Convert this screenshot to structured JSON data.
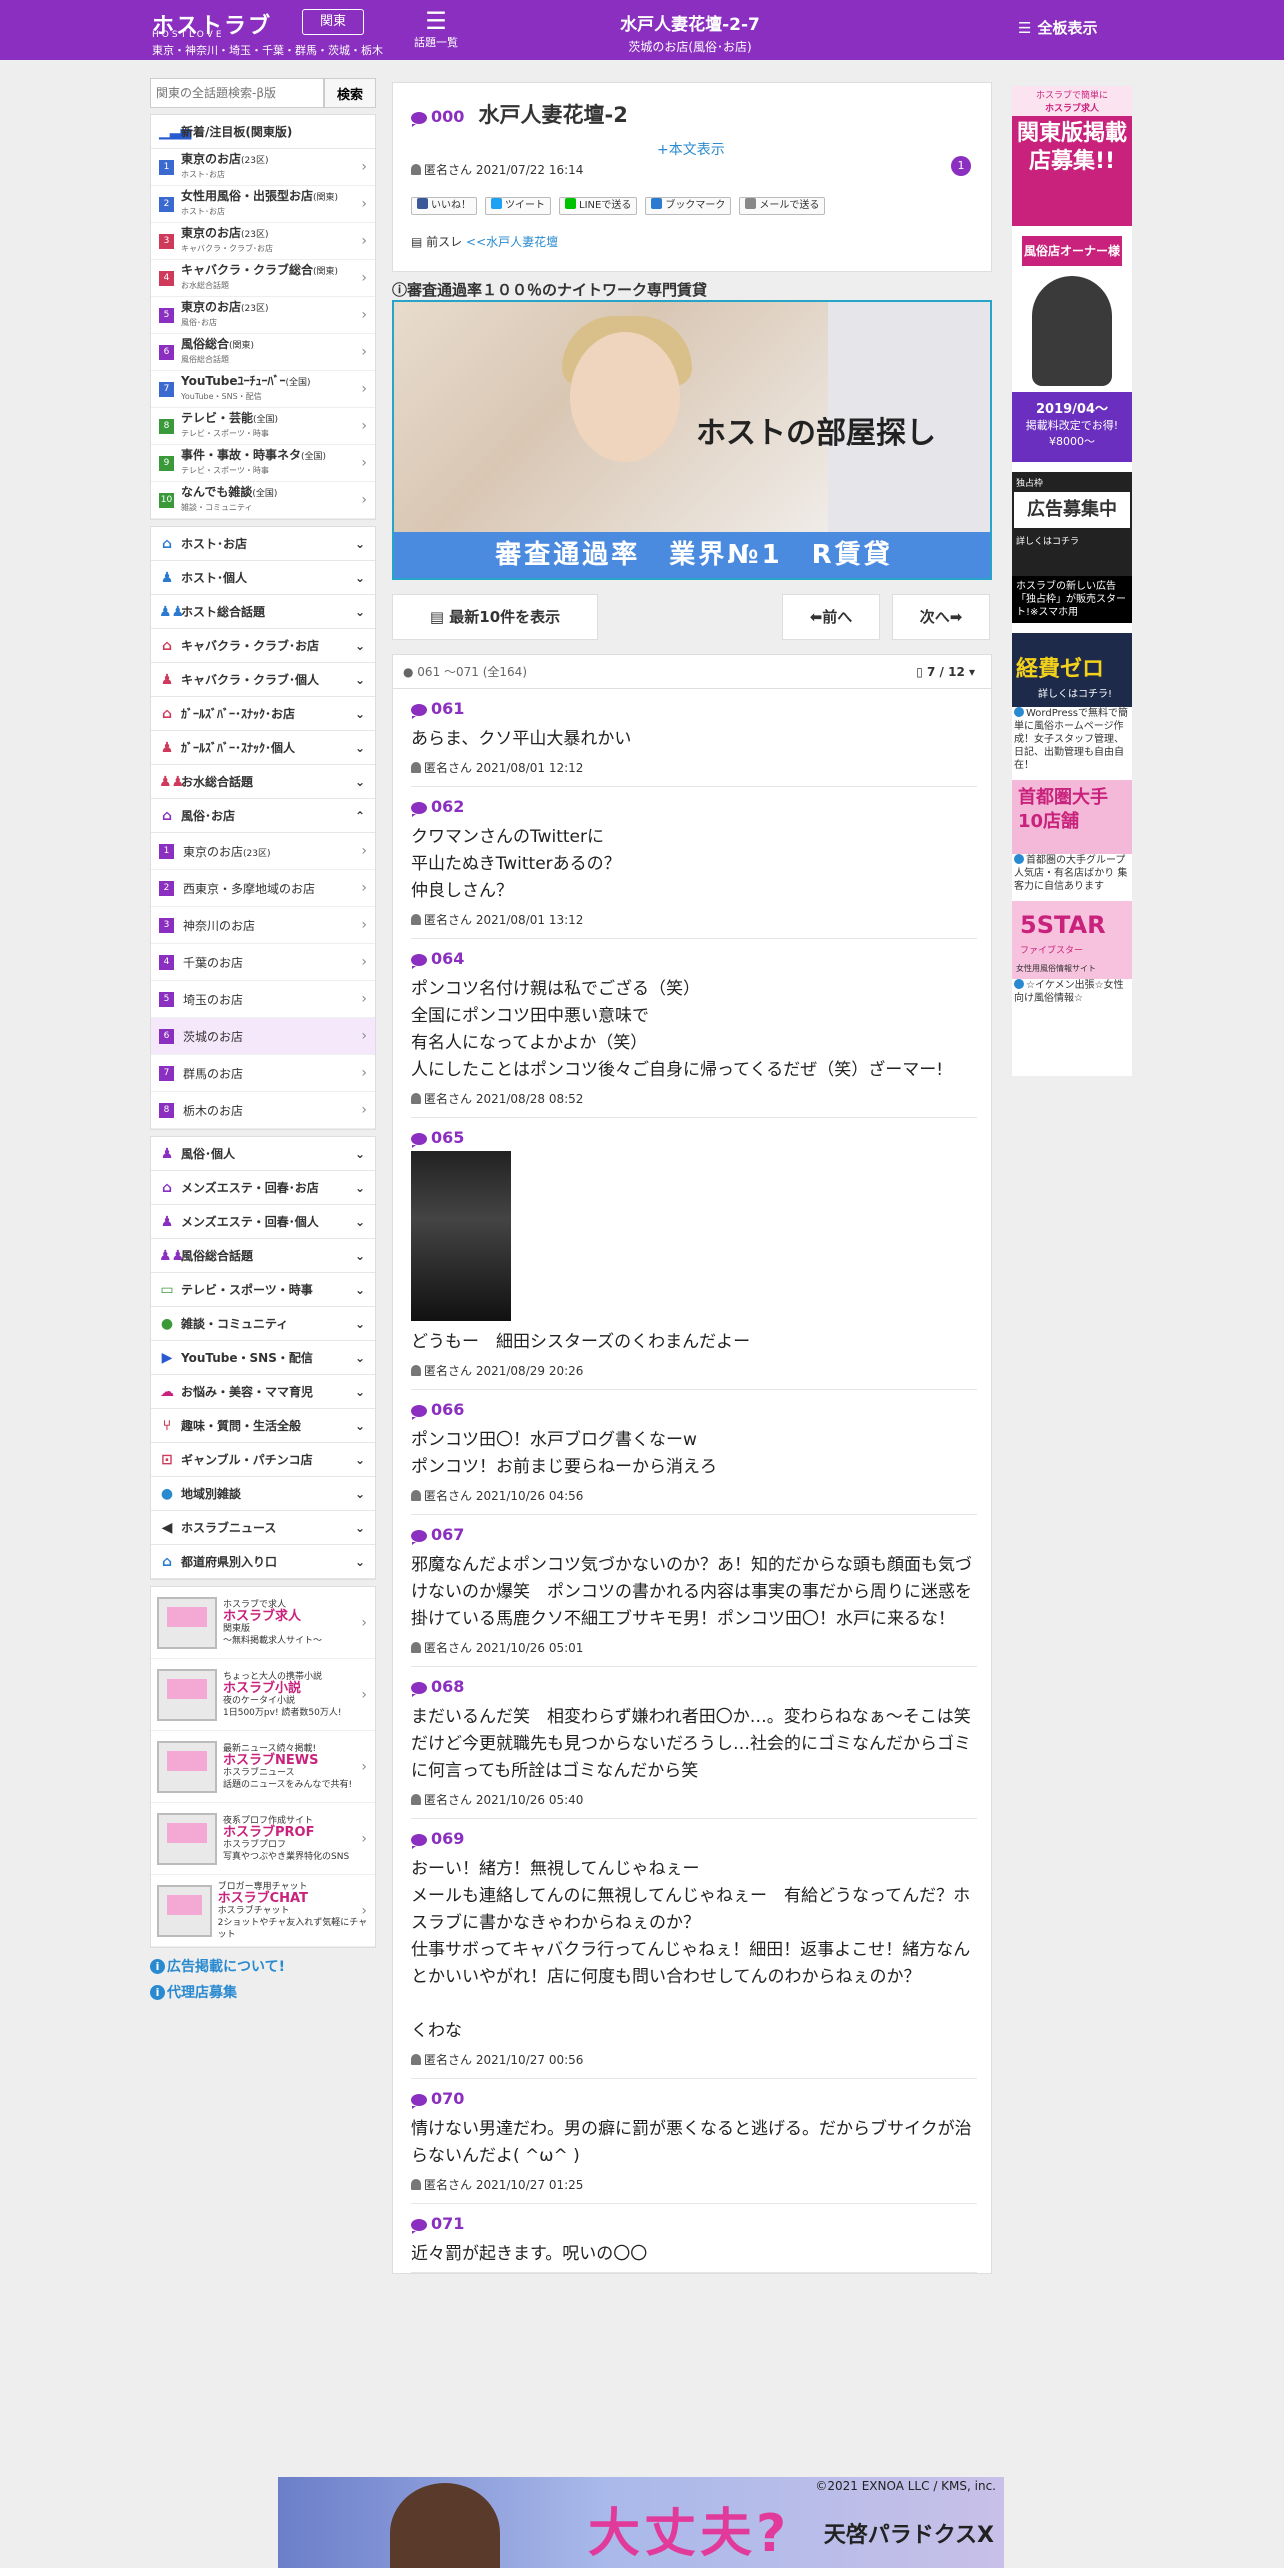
{
  "header": {
    "logo": "ホストラブ",
    "logo_sub": "HOSTLOVE",
    "region": "関東",
    "prefectures": "東京・神奈川・埼玉・千葉・群馬・茨城・栃木",
    "topics_label": "話題一覧",
    "thread_title": "水戸人妻花壇-2-7",
    "thread_category": "茨城のお店(風俗･お店)",
    "board_label": "全板表示"
  },
  "search": {
    "placeholder": "関東の全話題検索-β版",
    "button": "検索"
  },
  "sidebar": {
    "ranking_title": "新着/注目板(関東版)",
    "ranking": [
      {
        "n": "1",
        "label": "東京のお店",
        "tag": "(23区)",
        "sub": "ホスト･お店",
        "color": "#3a6ad0"
      },
      {
        "n": "2",
        "label": "女性用風俗・出張型お店",
        "tag": "(関東)",
        "sub": "ホスト･お店",
        "color": "#3a6ad0"
      },
      {
        "n": "3",
        "label": "東京のお店",
        "tag": "(23区)",
        "sub": "キャバクラ・クラブ･お店",
        "color": "#d03a5a"
      },
      {
        "n": "4",
        "label": "キャバクラ・クラブ総合",
        "tag": "(関東)",
        "sub": "お水総合話題",
        "color": "#d03a5a"
      },
      {
        "n": "5",
        "label": "東京のお店",
        "tag": "(23区)",
        "sub": "風俗･お店",
        "color": "#8a2fbf"
      },
      {
        "n": "6",
        "label": "風俗総合",
        "tag": "(関東)",
        "sub": "風俗総合話題",
        "color": "#8a2fbf"
      },
      {
        "n": "7",
        "label": "YouTubeﾕｰﾁｭｰﾊﾞｰ",
        "tag": "(全国)",
        "sub": "YouTube・SNS・配信",
        "color": "#3a6ad0"
      },
      {
        "n": "8",
        "label": "テレビ・芸能",
        "tag": "(全国)",
        "sub": "テレビ・スポーツ・時事",
        "color": "#3a9a3a"
      },
      {
        "n": "9",
        "label": "事件・事故・時事ネタ",
        "tag": "(全国)",
        "sub": "テレビ・スポーツ・時事",
        "color": "#3a9a3a"
      },
      {
        "n": "10",
        "label": "なんでも雑談",
        "tag": "(全国)",
        "sub": "雑談・コミュニティ",
        "color": "#3a9a3a"
      }
    ],
    "cat_host_shop": "ホスト･お店",
    "cat_host_person": "ホスト･個人",
    "cat_host_general": "ホスト総合話題",
    "cat_cabaret_shop": "キャバクラ・クラブ･お店",
    "cat_cabaret_person": "キャバクラ・クラブ･個人",
    "cat_girlsbar_shop": "ｶﾞｰﾙｽﾞﾊﾞｰ･ｽﾅｯｸ･お店",
    "cat_girlsbar_person": "ｶﾞｰﾙｽﾞﾊﾞｰ･ｽﾅｯｸ･個人",
    "cat_water_general": "お水総合話題",
    "cat_fuzoku_shop": "風俗･お店",
    "fuzoku_items": [
      {
        "n": "1",
        "label": "東京のお店",
        "tag": "(23区)"
      },
      {
        "n": "2",
        "label": "西東京・多摩地域のお店",
        "tag": ""
      },
      {
        "n": "3",
        "label": "神奈川のお店",
        "tag": ""
      },
      {
        "n": "4",
        "label": "千葉のお店",
        "tag": ""
      },
      {
        "n": "5",
        "label": "埼玉のお店",
        "tag": ""
      },
      {
        "n": "6",
        "label": "茨城のお店",
        "tag": ""
      },
      {
        "n": "7",
        "label": "群馬のお店",
        "tag": ""
      },
      {
        "n": "8",
        "label": "栃木のお店",
        "tag": ""
      }
    ],
    "cat_fuzoku_person": "風俗･個人",
    "cat_mens_shop": "メンズエステ・回春･お店",
    "cat_mens_person": "メンズエステ・回春･個人",
    "cat_fuzoku_general": "風俗総合話題",
    "cat_tv": "テレビ・スポーツ・時事",
    "cat_chat": "雑談・コミュニティ",
    "cat_youtube": "YouTube・SNS・配信",
    "cat_beauty": "お悩み・美容・ママ育児",
    "cat_hobby": "趣味・質問・生活全般",
    "cat_gamble": "ギャンブル・パチンコ店",
    "cat_region": "地域別雑談",
    "cat_news": "ホスラブニュース",
    "cat_pref": "都道府県別入り口",
    "banners": [
      {
        "tag": "ホスラブで求人",
        "title": "ホスラブ求人",
        "line1": "関東版",
        "line2": "〜無料掲載求人サイト〜"
      },
      {
        "tag": "ちょっと大人の携帯小説",
        "title": "ホスラブ小説",
        "line1": "夜のケータイ小説",
        "line2": "1日500万pv! 読者数50万人!"
      },
      {
        "tag": "最新ニュース続々掲載!",
        "title": "ホスラブNEWS",
        "line1": "ホスラブニュース",
        "line2": "話題のニュースをみんなで共有!"
      },
      {
        "tag": "夜系プロフ作成サイト",
        "title": "ホスラブPROF",
        "line1": "ホスラブプロフ",
        "line2": "写真やつぶやき業界特化のSNS"
      },
      {
        "tag": "ブロガー専用チャット",
        "title": "ホスラブCHAT",
        "line1": "ホスラブチャット",
        "line2": "2ショットやチャ友入れず気軽にチャット"
      }
    ],
    "link_ads": "広告掲載について!",
    "link_agency": "代理店募集"
  },
  "thread": {
    "id": "000",
    "title": "水戸人妻花壇-2",
    "toggle": "+本文表示",
    "author": "匿名さん",
    "date": "2021/07/22 16:14",
    "badge": "1",
    "share": [
      "いいね！",
      "ツイート",
      "LINEで送る",
      "ブックマーク",
      "メールで送る"
    ],
    "prev_label": "前スレ",
    "prev_link": "<<水戸人妻花壇"
  },
  "ad": {
    "heading": "審査通過率１００％のナイトワーク専門賃貸",
    "copy": "ホストの部屋探し",
    "bar": "審査通過率　業界№1　R賃貸"
  },
  "pager": {
    "latest": "最新10件を表示",
    "prev": "前へ",
    "next": "次へ"
  },
  "posts_head": {
    "range": "061 ～071 (全164)",
    "page": "7 / 12"
  },
  "posts": [
    {
      "id": "061",
      "body": "あらま、クソ平山大暴れかい",
      "author": "匿名さん",
      "date": "2021/08/01 12:12"
    },
    {
      "id": "062",
      "body": "クワマンさんのTwitterに\n平山たぬきTwitterあるの？\n仲良しさん？",
      "author": "匿名さん",
      "date": "2021/08/01 13:12"
    },
    {
      "id": "064",
      "body": "ポンコツ名付け親は私でござる（笑）\n全国にポンコツ田中悪い意味で\n有名人になってよかよか（笑）\n人にしたことはポンコツ後々ご自身に帰ってくるだぜ（笑）ざーマー!",
      "author": "匿名さん",
      "date": "2021/08/28 08:52"
    },
    {
      "id": "065",
      "body": "どうもー　細田シスターズのくわまんだよー",
      "author": "匿名さん",
      "date": "2021/08/29 20:26",
      "image": true
    },
    {
      "id": "066",
      "body": "ポンコツ田〇！水戸ブログ書くなーw\nポンコツ！お前まじ要らねーから消えろ",
      "author": "匿名さん",
      "date": "2021/10/26 04:56"
    },
    {
      "id": "067",
      "body": "邪魔なんだよポンコツ気づかないのか？あ！知的だからな頭も顔面も気づけないのか爆笑　ポンコツの書かれる内容は事実の事だから周りに迷惑を掛けている馬鹿クソ不細工ブサキモ男！ポンコツ田〇！水戸に来るな！",
      "author": "匿名さん",
      "date": "2021/10/26 05:01"
    },
    {
      "id": "068",
      "body": "まだいるんだ笑　相変わらず嫌われ者田〇か…。変わらねなぁ〜そこは笑　だけど今更就職先も見つからないだろうし…社会的にゴミなんだからゴミに何言っても所詮はゴミなんだから笑",
      "author": "匿名さん",
      "date": "2021/10/26 05:40"
    },
    {
      "id": "069",
      "body": "おーい！緒方！無視してんじゃねぇー\nメールも連絡してんのに無視してんじゃねぇー　有給どうなってんだ？ホスラブに書かなきゃわからねぇのか？\n仕事サボってキャバクラ行ってんじゃねぇ！細田！返事よこせ！緒方なんとかいいやがれ！店に何度も問い合わせしてんのわからねぇのか？\n\nくわな",
      "author": "匿名さん",
      "date": "2021/10/27 00:56"
    },
    {
      "id": "070",
      "body": "情けない男達だわ。男の癖に罰が悪くなると逃げる。だからブサイクが治らないんだよ( ^ω^ )",
      "author": "匿名さん",
      "date": "2021/10/27 01:25"
    },
    {
      "id": "071",
      "body": "近々罰が起きます。呪いの〇〇",
      "author": "",
      "date": ""
    }
  ],
  "right": {
    "ad1_tag": "ホスラブで簡単に",
    "ad1_title": "ホスラブ求人",
    "ad1_big": "関東版掲載店募集!!",
    "ad1_sub": "風俗店オーナー様へ",
    "ad1_date": "2019/04〜",
    "ad1_price": "掲載料改定でお得!¥8000〜",
    "ad2_tag": "独占枠",
    "ad2_big": "広告募集中",
    "ad2_more": "詳しくはコチラ",
    "ad2_text": "ホスラブの新しい広告「独占枠」が販売スタート!※スマホ用",
    "ad3_big": "経費ゼロ",
    "ad3_more": "詳しくはコチラ!",
    "ad3_text": "WordPressで無料で簡単に風俗ホームページ作成！女子スタッフ管理、日記、出勤管理も自由自在！",
    "ad4_big": "首都圏大手10店舗",
    "ad4_text": "首都圏の大手グループ 人気店・有名店ばかり 集客力に自信あります",
    "ad5_big": "5STAR",
    "ad5_sub": "ファイブスター",
    "ad5_cap": "女性用風俗情報サイト",
    "ad5_text": "☆イケメン出張☆女性向け風俗情報☆"
  },
  "bottom_ad": {
    "copyright": "©2021 EXNOA LLC / KMS, inc.",
    "text": "大丈夫?",
    "logo": "天啓パラドクスX"
  }
}
